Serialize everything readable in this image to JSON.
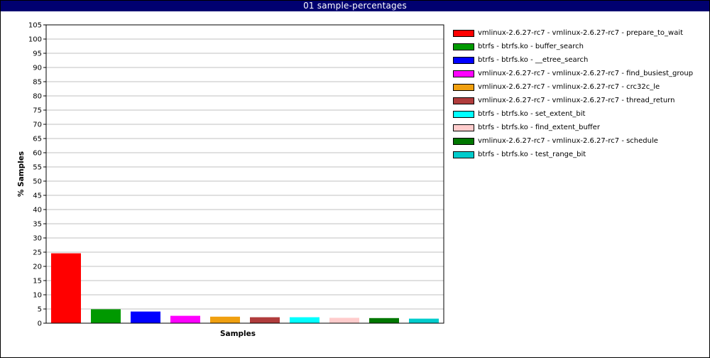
{
  "window": {
    "title": "01 sample-percentages"
  },
  "chart_data": {
    "type": "bar",
    "title": "01 sample-percentages",
    "xlabel": "Samples",
    "ylabel": "% Samples",
    "ylim": [
      0,
      105
    ],
    "ytick_step": 5,
    "grid": true,
    "legend_position": "right",
    "series": [
      {
        "name": "vmlinux-2.6.27-rc7 - vmlinux-2.6.27-rc7 - prepare_to_wait",
        "value": 24.6,
        "color": "#ff0000"
      },
      {
        "name": "btrfs - btrfs.ko - buffer_search",
        "value": 4.9,
        "color": "#009900"
      },
      {
        "name": "btrfs - btrfs.ko - __etree_search",
        "value": 4.1,
        "color": "#0000ff"
      },
      {
        "name": "vmlinux-2.6.27-rc7 - vmlinux-2.6.27-rc7 - find_busiest_group",
        "value": 2.6,
        "color": "#ff00ff"
      },
      {
        "name": "vmlinux-2.6.27-rc7 - vmlinux-2.6.27-rc7 - crc32c_le",
        "value": 2.3,
        "color": "#f0a010"
      },
      {
        "name": "vmlinux-2.6.27-rc7 - vmlinux-2.6.27-rc7 - thread_return",
        "value": 2.1,
        "color": "#b03c3c"
      },
      {
        "name": "btrfs - btrfs.ko - set_extent_bit",
        "value": 2.1,
        "color": "#00ffff"
      },
      {
        "name": "btrfs - btrfs.ko - find_extent_buffer",
        "value": 1.9,
        "color": "#ffcccc"
      },
      {
        "name": "vmlinux-2.6.27-rc7 - vmlinux-2.6.27-rc7 - schedule",
        "value": 1.8,
        "color": "#007700"
      },
      {
        "name": "btrfs - btrfs.ko - test_range_bit",
        "value": 1.6,
        "color": "#00cccc"
      }
    ]
  }
}
